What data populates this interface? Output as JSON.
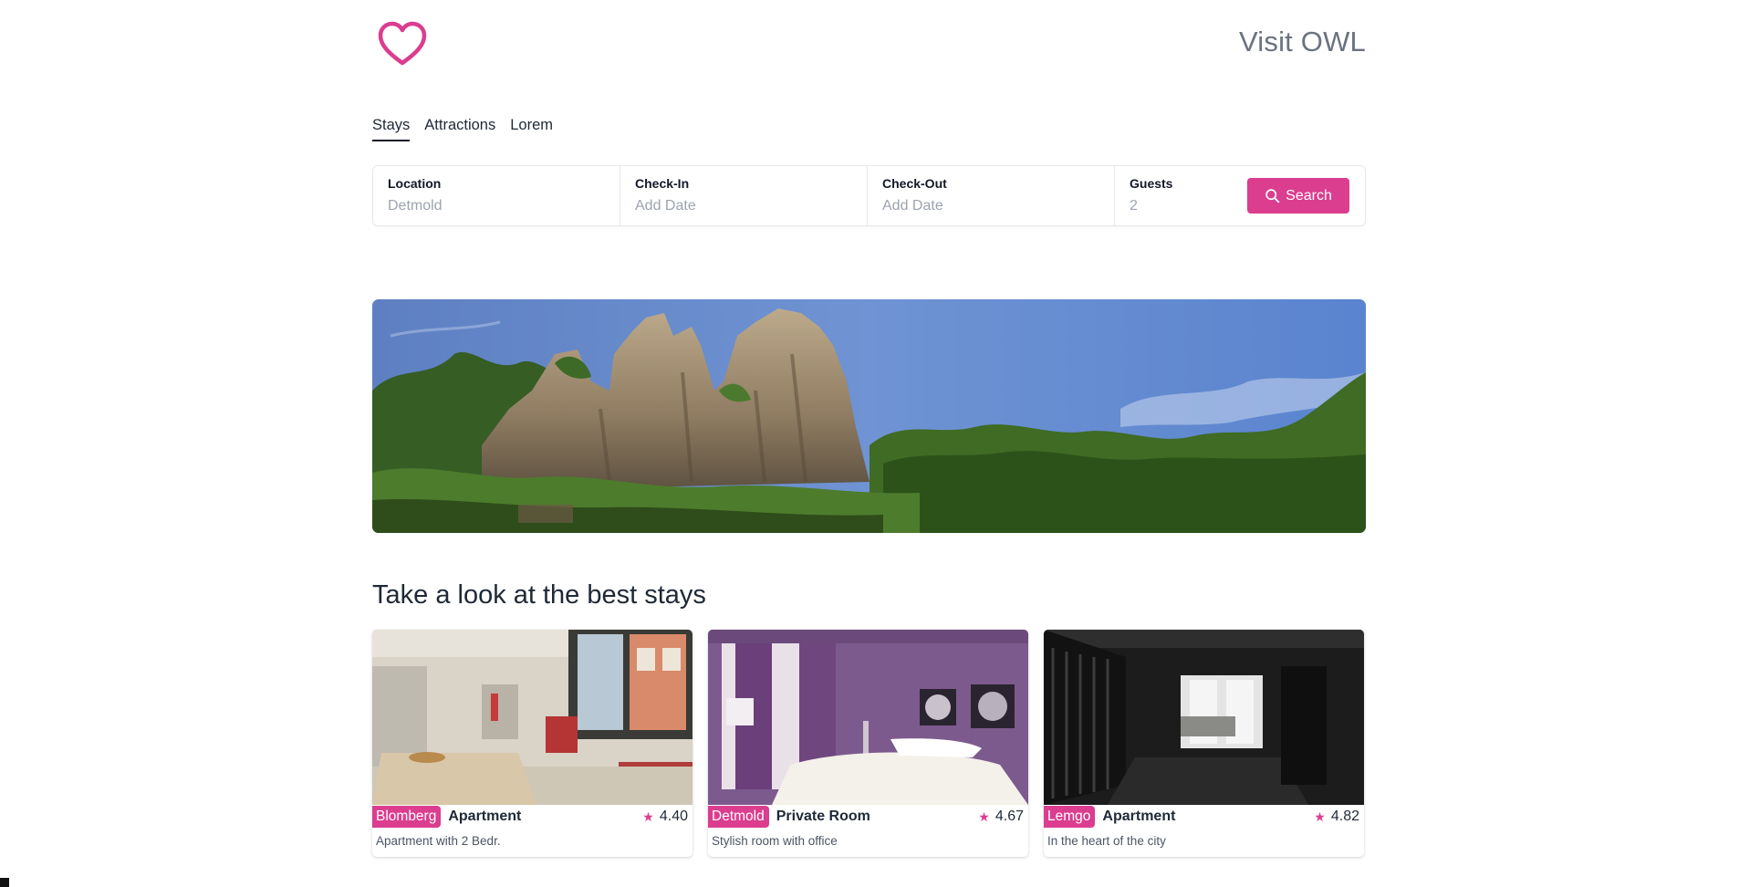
{
  "header": {
    "site_title": "Visit OWL"
  },
  "tabs": [
    {
      "label": "Stays",
      "active": true
    },
    {
      "label": "Attractions",
      "active": false
    },
    {
      "label": "Lorem",
      "active": false
    }
  ],
  "search": {
    "fields": [
      {
        "label": "Location",
        "value": "Detmold"
      },
      {
        "label": "Check-In",
        "value": "Add Date"
      },
      {
        "label": "Check-Out",
        "value": "Add Date"
      },
      {
        "label": "Guests",
        "value": "2"
      }
    ],
    "button_label": "Search"
  },
  "section": {
    "title": "Take a look at the best stays"
  },
  "stays": [
    {
      "city": "Blomberg",
      "type": "Apartment",
      "rating": "4.40",
      "description": "Apartment with 2 Bedr."
    },
    {
      "city": "Detmold",
      "type": "Private Room",
      "rating": "4.67",
      "description": "Stylish room with office"
    },
    {
      "city": "Lemgo",
      "type": "Apartment",
      "rating": "4.82",
      "description": "In the heart of the city"
    }
  ],
  "colors": {
    "accent": "#db3d8f",
    "text": "#1f2937",
    "muted": "#9ca3af"
  }
}
